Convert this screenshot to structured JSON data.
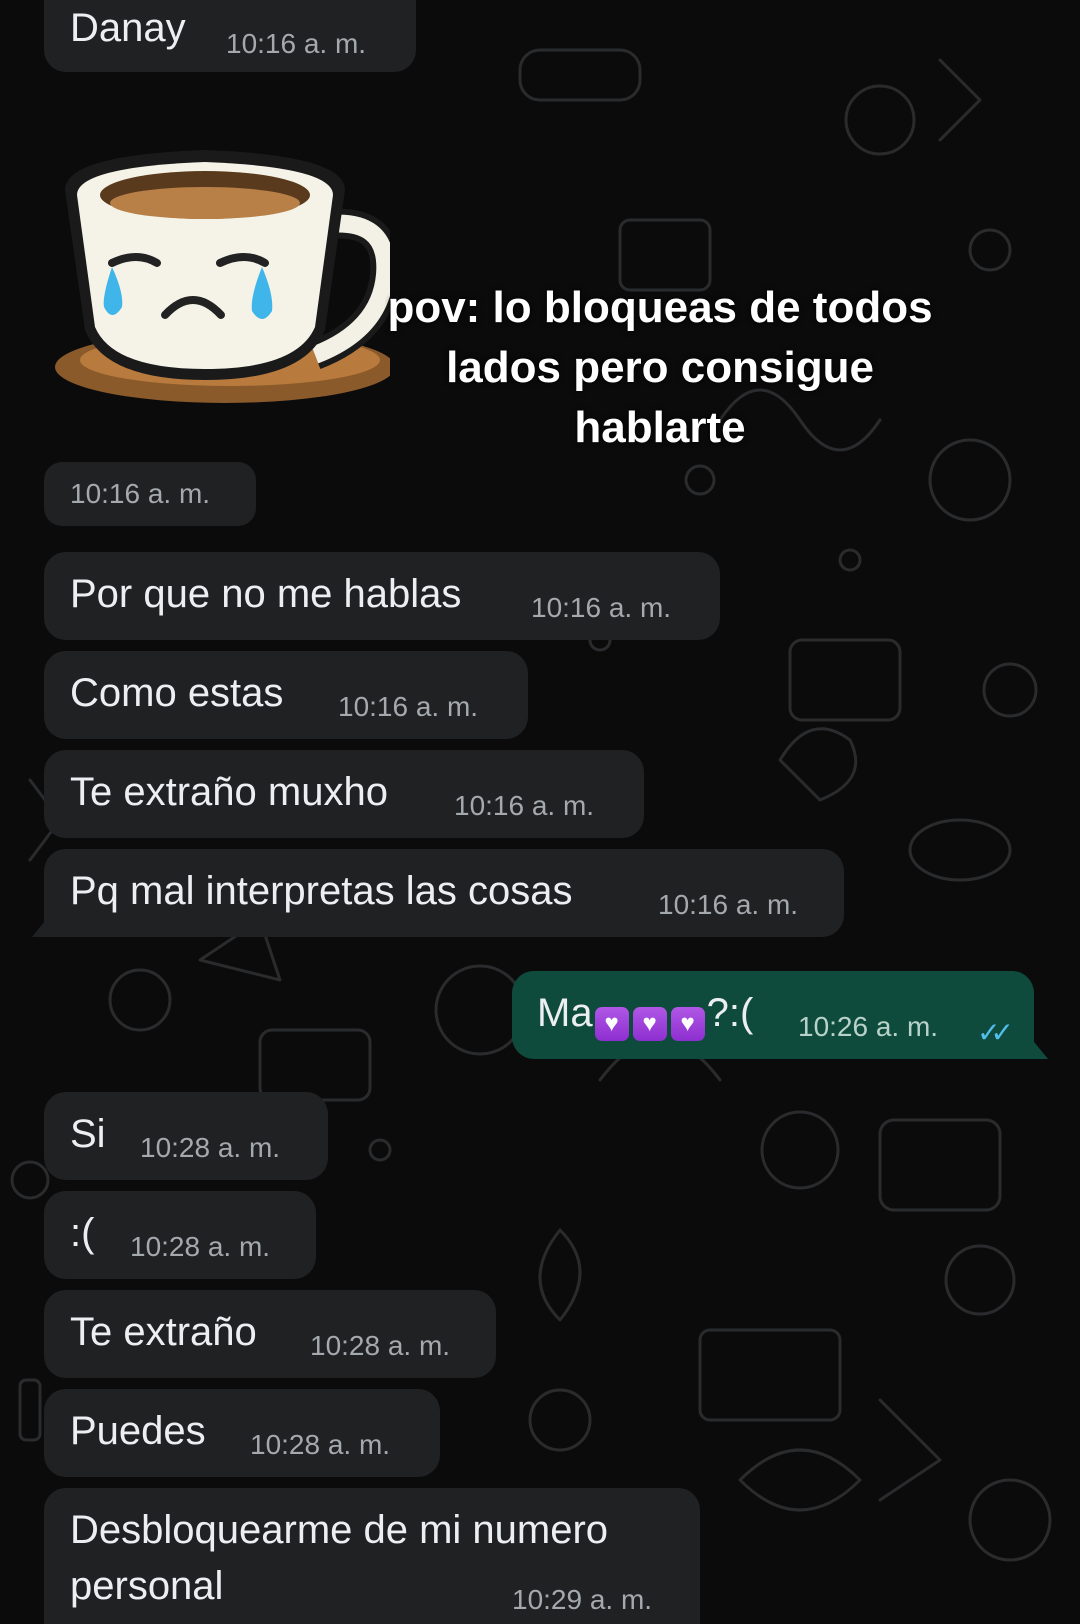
{
  "messages": [
    {
      "id": "m1",
      "from": "contact",
      "text": "Danay",
      "time": "10:16 a. m."
    },
    {
      "id": "sticker",
      "from": "contact",
      "type": "sticker",
      "sticker_icon": "crying-coffee-cup-sticker",
      "time": "10:16 a. m."
    },
    {
      "id": "m2",
      "from": "contact",
      "text": "Por que no me hablas",
      "time": "10:16 a. m."
    },
    {
      "id": "m3",
      "from": "contact",
      "text": "Como estas",
      "time": "10:16 a. m."
    },
    {
      "id": "m4",
      "from": "contact",
      "text": "Te extraño muxho",
      "time": "10:16 a. m."
    },
    {
      "id": "m5",
      "from": "contact",
      "text": "Pq mal interpretas las cosas",
      "time": "10:16 a. m."
    },
    {
      "id": "m6",
      "from": "me",
      "text_prefix": "Ma",
      "emoji": "purple-heart-emoji",
      "emoji_count": 3,
      "text_suffix": "?:(",
      "time": "10:26 a. m.",
      "status": "read"
    },
    {
      "id": "m7",
      "from": "contact",
      "text": "Si",
      "time": "10:28 a. m."
    },
    {
      "id": "m8",
      "from": "contact",
      "text": ":(",
      "time": "10:28 a. m."
    },
    {
      "id": "m9",
      "from": "contact",
      "text": "Te extraño",
      "time": "10:28 a. m."
    },
    {
      "id": "m10",
      "from": "contact",
      "text": "Puedes",
      "time": "10:28 a. m."
    },
    {
      "id": "m11",
      "from": "contact",
      "text_line1": "Desbloquearme de mi numero",
      "text_line2": "personal",
      "time": "10:29 a. m."
    }
  ],
  "overlay_caption": {
    "line1": "pov: lo bloqueas de todos",
    "line2": "lados pero consigue",
    "line3": "hablarte"
  },
  "colors": {
    "background": "#0b0b0c",
    "incoming_bubble": "#202123",
    "outgoing_bubble": "#0f4b3c",
    "read_ticks": "#53bdeb",
    "heart": "#9b3fe0"
  },
  "icons": {
    "read_receipt": "double-check-icon"
  }
}
